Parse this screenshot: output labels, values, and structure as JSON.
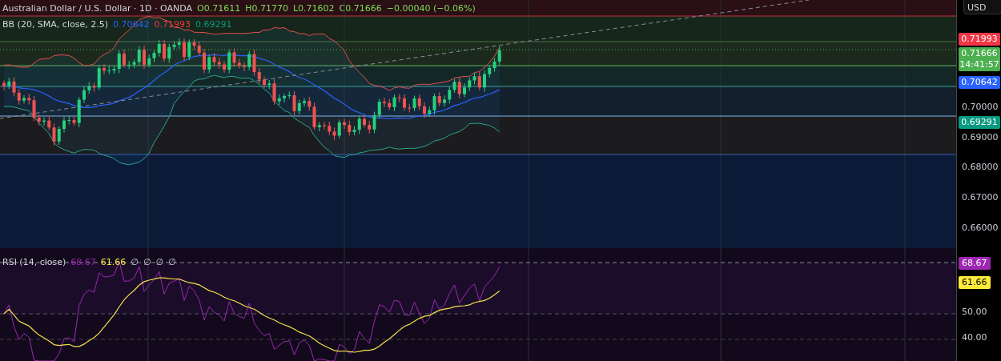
{
  "legend": {
    "symbol": "Australian Dollar / U.S. Dollar · 1D · OANDA",
    "ohlc": [
      {
        "label": "O",
        "value": "0.71611"
      },
      {
        "label": "H",
        "value": "0.71770"
      },
      {
        "label": "L",
        "value": "0.71602"
      },
      {
        "label": "C",
        "value": "0.71666"
      }
    ],
    "change": "−0.00040 (−0.06%)"
  },
  "bollinger": {
    "label": "BB (20, SMA, close, 2.5)",
    "values": [
      {
        "value": "0.70642",
        "color": "#2962ff"
      },
      {
        "value": "0.71993",
        "color": "#f23645"
      },
      {
        "value": "0.69291",
        "color": "#089981"
      }
    ]
  },
  "price_axis": {
    "currency": "USD",
    "ticks": [
      "0.70000",
      "0.69000",
      "0.68000",
      "0.67000",
      "0.66000"
    ],
    "badges": [
      {
        "value": "0.71993",
        "color": "#f23645"
      },
      {
        "value": "0.71666",
        "color": "#4caf50",
        "countdown": "14:41:57"
      },
      {
        "value": "0.70642",
        "color": "#2962ff"
      },
      {
        "value": "0.69291",
        "color": "#089981"
      }
    ]
  },
  "rsi": {
    "label": "RSI (14, close)",
    "values": [
      {
        "value": "68.67",
        "color": "#9c27b0"
      },
      {
        "value": "61.66",
        "color": "#ffeb3b"
      }
    ],
    "extras": [
      "∅",
      "∅",
      "∅",
      "∅"
    ],
    "ticks": [
      "50.00",
      "40.00"
    ],
    "badges": [
      {
        "value": "68.67",
        "color": "#9c27b0"
      },
      {
        "value": "61.66",
        "color": "#ffeb3b"
      }
    ]
  }
}
